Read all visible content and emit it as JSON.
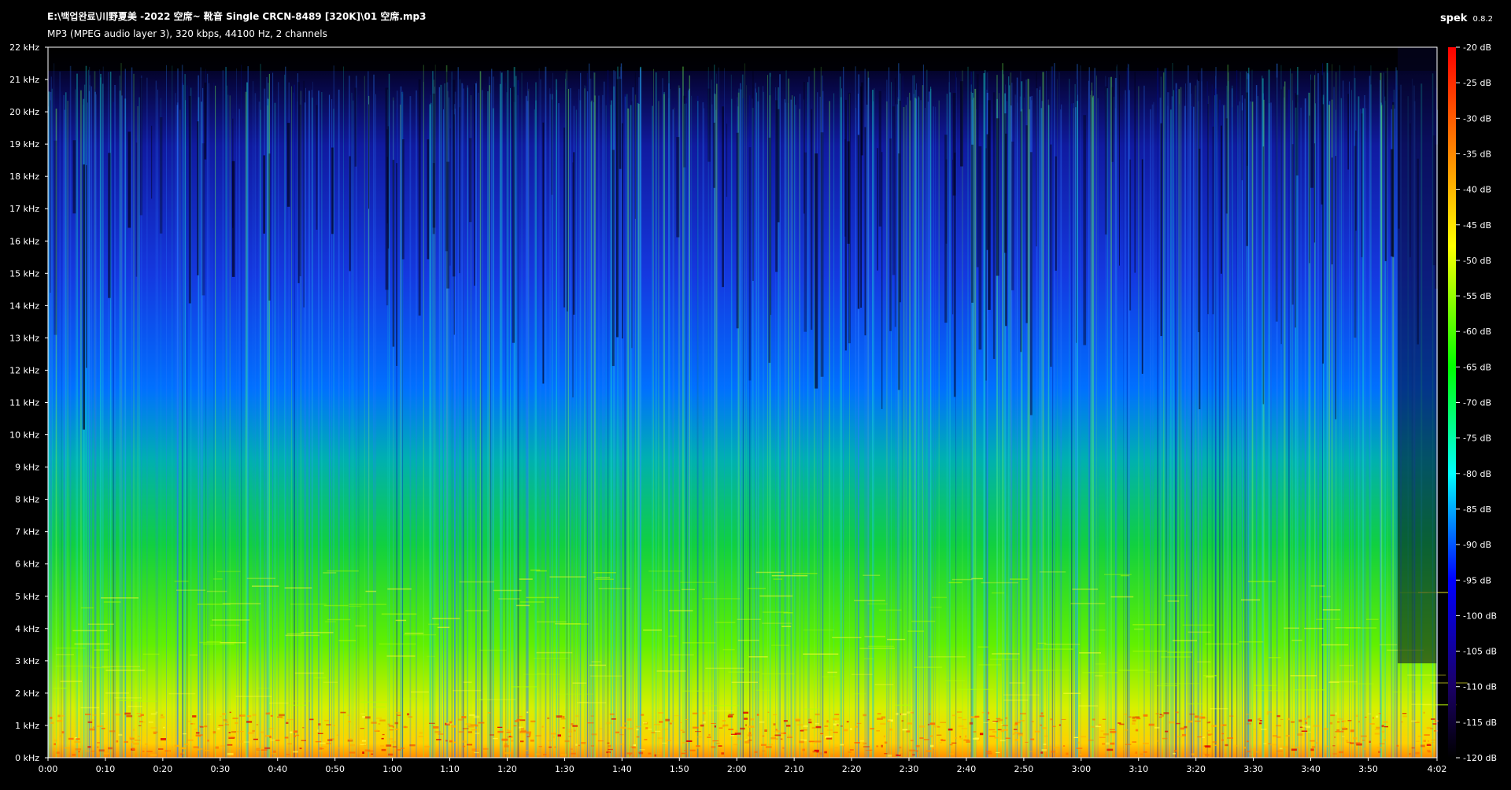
{
  "header": {
    "file_path": "E:\\백업완료\\川野夏美 -2022 空席~ 靴音 Single CRCN-8489 [320K]\\01 空席.mp3",
    "file_info": "MP3 (MPEG audio layer 3), 320 kbps, 44100 Hz, 2 channels",
    "app_name": "spek",
    "app_version": "0.8.2"
  },
  "chart_data": {
    "type": "heatmap",
    "title": "E:\\백업완료\\川野夏美 -2022 空席~ 靴音 Single CRCN-8489 [320K]\\01 空席.mp3",
    "subtitle": "MP3 (MPEG audio layer 3), 320 kbps, 44100 Hz, 2 channels",
    "x_axis": {
      "unit": "time (m:ss)",
      "range": [
        "0:00",
        "4:02"
      ],
      "range_seconds": [
        0,
        242
      ],
      "ticks": [
        "0:00",
        "0:10",
        "0:20",
        "0:30",
        "0:40",
        "0:50",
        "1:00",
        "1:10",
        "1:20",
        "1:30",
        "1:40",
        "1:50",
        "2:00",
        "2:10",
        "2:20",
        "2:30",
        "2:40",
        "2:50",
        "3:00",
        "3:10",
        "3:20",
        "3:30",
        "3:40",
        "3:50",
        "4:02"
      ],
      "tick_seconds": [
        0,
        10,
        20,
        30,
        40,
        50,
        60,
        70,
        80,
        90,
        100,
        110,
        120,
        130,
        140,
        150,
        160,
        170,
        180,
        190,
        200,
        210,
        220,
        230,
        242
      ]
    },
    "y_axis": {
      "unit": "kHz",
      "range": [
        0,
        22
      ],
      "ticks": [
        "0 kHz",
        "1 kHz",
        "2 kHz",
        "3 kHz",
        "4 kHz",
        "5 kHz",
        "6 kHz",
        "7 kHz",
        "8 kHz",
        "9 kHz",
        "10 kHz",
        "11 kHz",
        "12 kHz",
        "13 kHz",
        "14 kHz",
        "15 kHz",
        "16 kHz",
        "17 kHz",
        "18 kHz",
        "19 kHz",
        "20 kHz",
        "21 kHz",
        "22 kHz"
      ]
    },
    "color_scale": {
      "unit": "dB",
      "range": [
        -120,
        -20
      ],
      "ticks": [
        "-20 dB",
        "-25 dB",
        "-30 dB",
        "-35 dB",
        "-40 dB",
        "-45 dB",
        "-50 dB",
        "-55 dB",
        "-60 dB",
        "-65 dB",
        "-70 dB",
        "-75 dB",
        "-80 dB",
        "-85 dB",
        "-90 dB",
        "-95 dB",
        "-100 dB",
        "-105 dB",
        "-110 dB",
        "-115 dB",
        "-120 dB"
      ],
      "colors": [
        "#000000",
        "#1a0066",
        "#0000ff",
        "#00ffff",
        "#00ff00",
        "#ffff00",
        "#ff8000",
        "#ff0000"
      ]
    },
    "grid": false
  }
}
